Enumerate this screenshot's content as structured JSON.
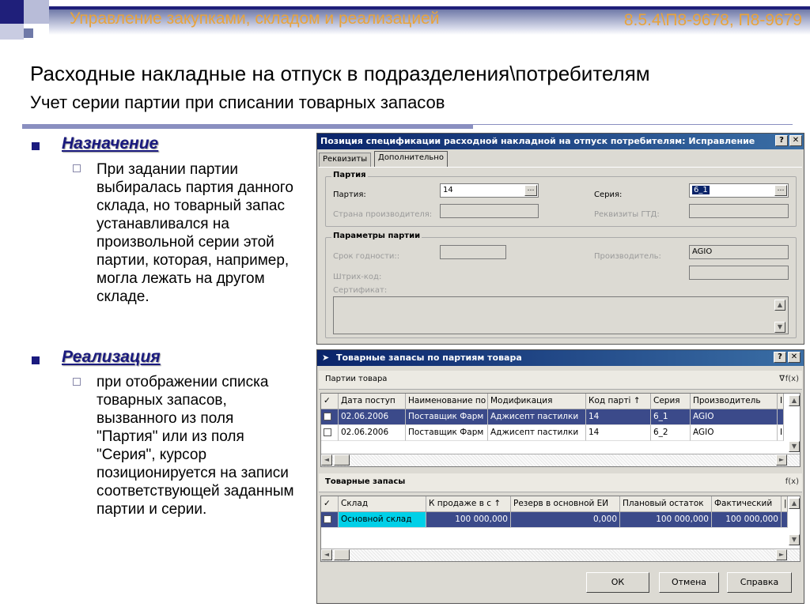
{
  "header": {
    "section_title": "Управление закупками, складом и реализацией",
    "doc_ref": "8.5.4\\П8-9678, П8-9679"
  },
  "title": "Расходные накладные на отпуск в подразделения\\потребителям",
  "subtitle": "Учет серии партии при списании товарных запасов",
  "bullets": [
    {
      "heading": "Назначение",
      "text": "При задании партии выбиралась партия данного склада, но товарный запас устанавливался на произвольной серии этой партии, которая, например, могла лежать на другом складе."
    },
    {
      "heading": "Реализация",
      "text": "при отображении списка товарных запасов, вызванного из поля \"Партия\" или из поля \"Серия\", курсор позиционируется на записи соответствующей заданным партии и серии."
    }
  ],
  "dialog1": {
    "title": "Позиция спецификации расходной накладной на отпуск потребителям: Исправление",
    "help_btn": "?",
    "close_btn": "✕",
    "tabs": [
      "Реквизиты",
      "Дополнительно"
    ],
    "group_batch": {
      "label": "Партия",
      "batch_label": "Партия:",
      "batch_value": "14",
      "series_label": "Серия:",
      "series_value": "6_1",
      "country_label": "Страна производителя:",
      "gtd_label": "Реквизиты ГТД:"
    },
    "group_params": {
      "label": "Параметры партии",
      "expiry_label": "Срок годности::",
      "producer_label": "Производитель:",
      "producer_value": "AGIO",
      "barcode_label": "Штрих-код:",
      "cert_label": "Сертификат:"
    },
    "ellipsis": "…"
  },
  "dialog2": {
    "title": "Товарные запасы по партиям товара",
    "help_btn": "?",
    "close_btn": "✕",
    "batches_bar": "Партии товара",
    "filter_icon": "∇",
    "fx": "f(x)",
    "batches_grid": {
      "columns": [
        "✓",
        "Дата поступ",
        "Наименование по",
        "Модификация",
        "Код парті ↑",
        "Серия",
        "Производитель",
        "I"
      ],
      "rows": [
        [
          "",
          "02.06.2006",
          "Поставщик Фарм",
          "Аджисепт пастилки",
          "14",
          "6_1",
          "AGIO",
          ""
        ],
        [
          "",
          "02.06.2006",
          "Поставщик Фарм",
          "Аджисепт пастилки",
          "14",
          "6_2",
          "AGIO",
          "I"
        ]
      ]
    },
    "stock_bar": "Товарные запасы",
    "stock_grid": {
      "columns": [
        "✓",
        "Склад",
        "К продаже в с ↑",
        "Резерв в основной ЕИ",
        "Плановый остаток",
        "Фактический",
        "|"
      ],
      "rows": [
        [
          "",
          "Основной склад",
          "100 000,000",
          "0,000",
          "100 000,000",
          "100 000,000",
          ""
        ]
      ]
    },
    "buttons": {
      "ok": "ОК",
      "cancel": "Отмена",
      "help": "Справка"
    }
  },
  "colors": {
    "accent_orange": "#e8a33b",
    "navy": "#1a1a7e",
    "title_bar": "#0a246a",
    "selected_row": "#3b4a8a",
    "cursor_cell": "#00d0e8"
  }
}
